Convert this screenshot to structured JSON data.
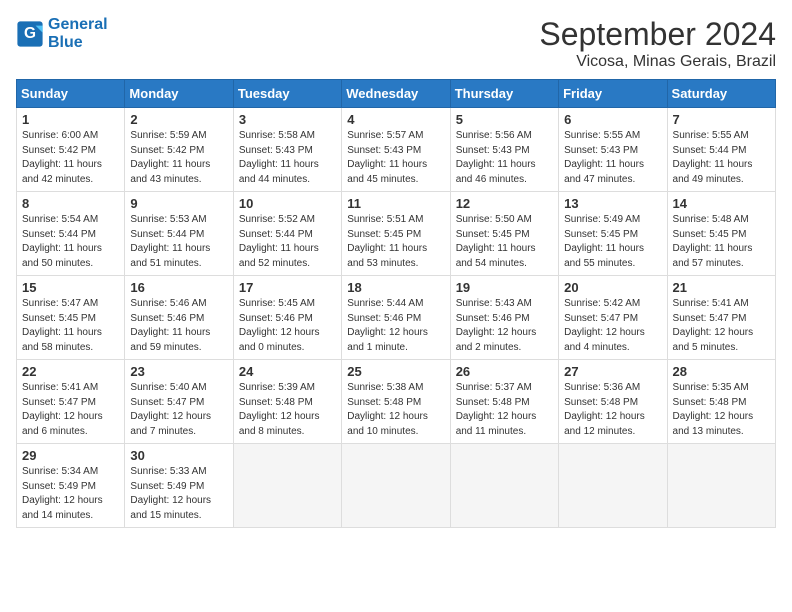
{
  "logo": {
    "line1": "General",
    "line2": "Blue"
  },
  "title": "September 2024",
  "location": "Vicosa, Minas Gerais, Brazil",
  "weekdays": [
    "Sunday",
    "Monday",
    "Tuesday",
    "Wednesday",
    "Thursday",
    "Friday",
    "Saturday"
  ],
  "weeks": [
    [
      {
        "day": "1",
        "info": "Sunrise: 6:00 AM\nSunset: 5:42 PM\nDaylight: 11 hours\nand 42 minutes."
      },
      {
        "day": "2",
        "info": "Sunrise: 5:59 AM\nSunset: 5:42 PM\nDaylight: 11 hours\nand 43 minutes."
      },
      {
        "day": "3",
        "info": "Sunrise: 5:58 AM\nSunset: 5:43 PM\nDaylight: 11 hours\nand 44 minutes."
      },
      {
        "day": "4",
        "info": "Sunrise: 5:57 AM\nSunset: 5:43 PM\nDaylight: 11 hours\nand 45 minutes."
      },
      {
        "day": "5",
        "info": "Sunrise: 5:56 AM\nSunset: 5:43 PM\nDaylight: 11 hours\nand 46 minutes."
      },
      {
        "day": "6",
        "info": "Sunrise: 5:55 AM\nSunset: 5:43 PM\nDaylight: 11 hours\nand 47 minutes."
      },
      {
        "day": "7",
        "info": "Sunrise: 5:55 AM\nSunset: 5:44 PM\nDaylight: 11 hours\nand 49 minutes."
      }
    ],
    [
      {
        "day": "8",
        "info": "Sunrise: 5:54 AM\nSunset: 5:44 PM\nDaylight: 11 hours\nand 50 minutes."
      },
      {
        "day": "9",
        "info": "Sunrise: 5:53 AM\nSunset: 5:44 PM\nDaylight: 11 hours\nand 51 minutes."
      },
      {
        "day": "10",
        "info": "Sunrise: 5:52 AM\nSunset: 5:44 PM\nDaylight: 11 hours\nand 52 minutes."
      },
      {
        "day": "11",
        "info": "Sunrise: 5:51 AM\nSunset: 5:45 PM\nDaylight: 11 hours\nand 53 minutes."
      },
      {
        "day": "12",
        "info": "Sunrise: 5:50 AM\nSunset: 5:45 PM\nDaylight: 11 hours\nand 54 minutes."
      },
      {
        "day": "13",
        "info": "Sunrise: 5:49 AM\nSunset: 5:45 PM\nDaylight: 11 hours\nand 55 minutes."
      },
      {
        "day": "14",
        "info": "Sunrise: 5:48 AM\nSunset: 5:45 PM\nDaylight: 11 hours\nand 57 minutes."
      }
    ],
    [
      {
        "day": "15",
        "info": "Sunrise: 5:47 AM\nSunset: 5:45 PM\nDaylight: 11 hours\nand 58 minutes."
      },
      {
        "day": "16",
        "info": "Sunrise: 5:46 AM\nSunset: 5:46 PM\nDaylight: 11 hours\nand 59 minutes."
      },
      {
        "day": "17",
        "info": "Sunrise: 5:45 AM\nSunset: 5:46 PM\nDaylight: 12 hours\nand 0 minutes."
      },
      {
        "day": "18",
        "info": "Sunrise: 5:44 AM\nSunset: 5:46 PM\nDaylight: 12 hours\nand 1 minute."
      },
      {
        "day": "19",
        "info": "Sunrise: 5:43 AM\nSunset: 5:46 PM\nDaylight: 12 hours\nand 2 minutes."
      },
      {
        "day": "20",
        "info": "Sunrise: 5:42 AM\nSunset: 5:47 PM\nDaylight: 12 hours\nand 4 minutes."
      },
      {
        "day": "21",
        "info": "Sunrise: 5:41 AM\nSunset: 5:47 PM\nDaylight: 12 hours\nand 5 minutes."
      }
    ],
    [
      {
        "day": "22",
        "info": "Sunrise: 5:41 AM\nSunset: 5:47 PM\nDaylight: 12 hours\nand 6 minutes."
      },
      {
        "day": "23",
        "info": "Sunrise: 5:40 AM\nSunset: 5:47 PM\nDaylight: 12 hours\nand 7 minutes."
      },
      {
        "day": "24",
        "info": "Sunrise: 5:39 AM\nSunset: 5:48 PM\nDaylight: 12 hours\nand 8 minutes."
      },
      {
        "day": "25",
        "info": "Sunrise: 5:38 AM\nSunset: 5:48 PM\nDaylight: 12 hours\nand 10 minutes."
      },
      {
        "day": "26",
        "info": "Sunrise: 5:37 AM\nSunset: 5:48 PM\nDaylight: 12 hours\nand 11 minutes."
      },
      {
        "day": "27",
        "info": "Sunrise: 5:36 AM\nSunset: 5:48 PM\nDaylight: 12 hours\nand 12 minutes."
      },
      {
        "day": "28",
        "info": "Sunrise: 5:35 AM\nSunset: 5:48 PM\nDaylight: 12 hours\nand 13 minutes."
      }
    ],
    [
      {
        "day": "29",
        "info": "Sunrise: 5:34 AM\nSunset: 5:49 PM\nDaylight: 12 hours\nand 14 minutes."
      },
      {
        "day": "30",
        "info": "Sunrise: 5:33 AM\nSunset: 5:49 PM\nDaylight: 12 hours\nand 15 minutes."
      },
      {
        "day": "",
        "info": ""
      },
      {
        "day": "",
        "info": ""
      },
      {
        "day": "",
        "info": ""
      },
      {
        "day": "",
        "info": ""
      },
      {
        "day": "",
        "info": ""
      }
    ]
  ]
}
